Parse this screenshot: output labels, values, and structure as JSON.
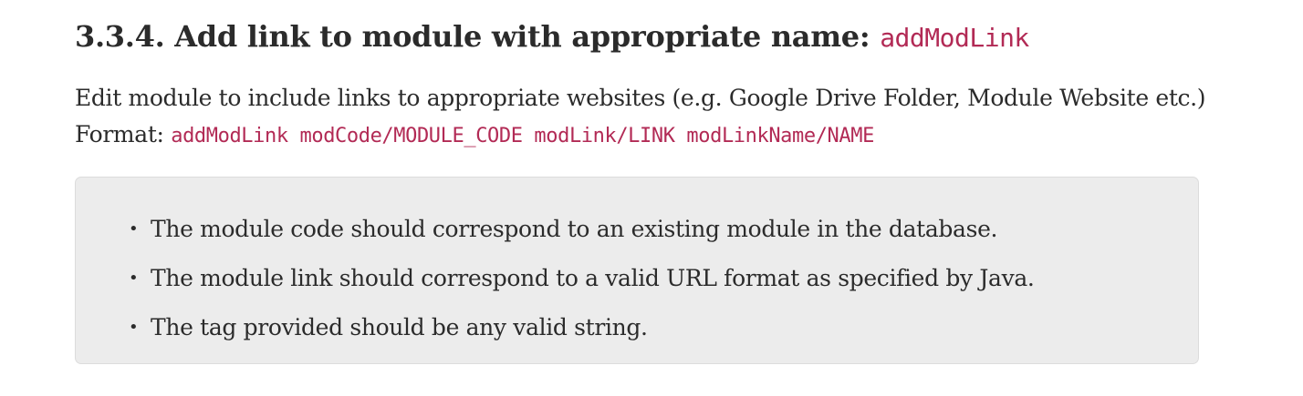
{
  "heading": {
    "text": "3.3.4. Add link to module with appropriate name: ",
    "command": "addModLink"
  },
  "description": {
    "line1": "Edit module to include links to appropriate websites (e.g. Google Drive Folder, Module Website etc.)",
    "format_label": "Format: ",
    "format_code": "addModLink modCode/MODULE_CODE modLink/LINK modLinkName/NAME"
  },
  "notes": {
    "bullet_glyph": "•",
    "items": [
      "The module code should correspond to an existing module in the database.",
      "The module link should correspond to a valid URL format as specified by Java.",
      "The tag provided should be any valid string."
    ]
  },
  "colors": {
    "code_text": "#b22a55",
    "body_text": "#2b2b2b",
    "callout_background": "#ececec",
    "callout_border": "#dcdcdc"
  }
}
